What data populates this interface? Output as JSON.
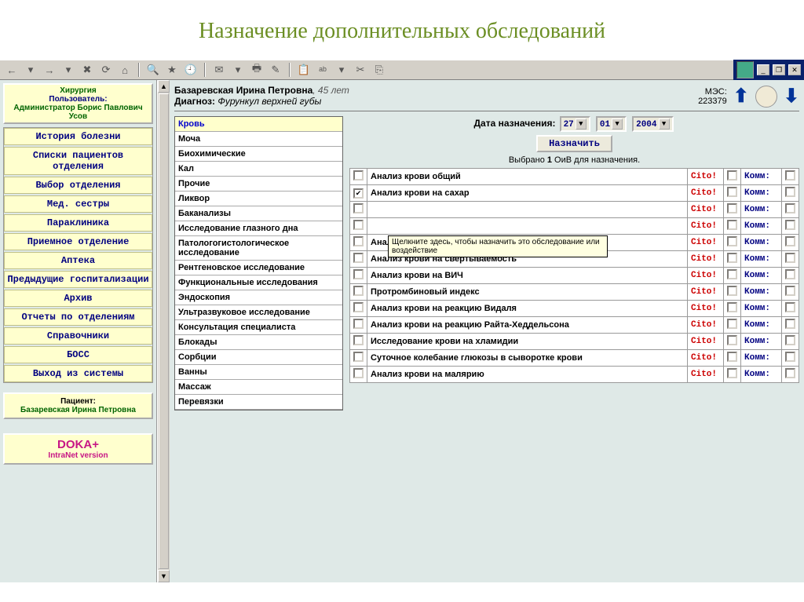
{
  "slide_title": "Назначение дополнительных обследований",
  "toolbar_icons": [
    {
      "name": "back",
      "glyph": "←"
    },
    {
      "name": "back-menu",
      "glyph": "▾"
    },
    {
      "name": "forward",
      "glyph": "→"
    },
    {
      "name": "forward-menu",
      "glyph": "▾"
    },
    {
      "name": "stop",
      "glyph": "✖"
    },
    {
      "name": "refresh",
      "glyph": "⟳"
    },
    {
      "name": "home",
      "glyph": "⌂"
    },
    {
      "name": "sep",
      "glyph": ""
    },
    {
      "name": "search",
      "glyph": "🔍"
    },
    {
      "name": "favorites",
      "glyph": "★"
    },
    {
      "name": "history",
      "glyph": "🕘"
    },
    {
      "name": "sep",
      "glyph": ""
    },
    {
      "name": "mail",
      "glyph": "✉"
    },
    {
      "name": "mail-menu",
      "glyph": "▾"
    },
    {
      "name": "print",
      "glyph": "🖶"
    },
    {
      "name": "edit",
      "glyph": "✎"
    },
    {
      "name": "sep",
      "glyph": ""
    },
    {
      "name": "paste",
      "glyph": "📋"
    },
    {
      "name": "spell",
      "glyph": "ᵃᵇ"
    },
    {
      "name": "spell-menu",
      "glyph": "▾"
    },
    {
      "name": "cut",
      "glyph": "✂"
    },
    {
      "name": "copy",
      "glyph": "⎘"
    }
  ],
  "sidebar": {
    "card1_line1": "Хирургия",
    "card1_line2": "Пользователь:",
    "card1_line3": "Администратор Борис Павлович Усов",
    "nav": [
      "История болезни",
      "Списки пациентов отделения",
      "Выбор отделения",
      "Мед. сестры",
      "Параклиника",
      "Приемное отделение",
      "Аптека",
      "Предыдущие госпитализации",
      "Архив",
      "Отчеты по отделениям",
      "Справочники",
      "БОСС",
      "Выход из системы"
    ],
    "patient_label": "Пациент:",
    "patient_name": "Базаревская Ирина Петровна",
    "brand1": "DOKA+",
    "brand2": "IntraNet version"
  },
  "header": {
    "patient_name": "Базаревская Ирина Петровна",
    "patient_age": ", 45 лет",
    "diag_label": "Диагноз: ",
    "diag_value": "Фурункул верхней губы",
    "mes_label": "МЭС:",
    "mes_value": "223379"
  },
  "categories": [
    {
      "label": "Кровь",
      "active": true
    },
    {
      "label": "Моча"
    },
    {
      "label": "Биохимические"
    },
    {
      "label": "Кал"
    },
    {
      "label": "Прочие"
    },
    {
      "label": "Ликвор"
    },
    {
      "label": "Баканализы"
    },
    {
      "label": "Исследование глазного дна"
    },
    {
      "label": "Патологогистологическое исследование"
    },
    {
      "label": "Рентгеновское исследование"
    },
    {
      "label": "Функциональные исследования"
    },
    {
      "label": "Эндоскопия"
    },
    {
      "label": "Ультразвуковое исследование"
    },
    {
      "label": "Консультация специалиста"
    },
    {
      "label": "Блокады"
    },
    {
      "label": "Сорбции"
    },
    {
      "label": "Ванны"
    },
    {
      "label": "Массаж"
    },
    {
      "label": "Перевязки"
    }
  ],
  "date_section": {
    "label": "Дата назначения:",
    "day": "27",
    "month": "01",
    "year": "2004",
    "assign_btn": "Назначить",
    "picked_prefix": "Выбрано ",
    "picked_count": "1",
    "picked_suffix": " ОиВ для назначения."
  },
  "cito_label": "Cito!",
  "comm_label": "Комм:",
  "exams": [
    {
      "name": "Анализ крови общий",
      "checked": false
    },
    {
      "name": "Анализ крови на сахар",
      "checked": true
    },
    {
      "name": "",
      "checked": false
    },
    {
      "name": "",
      "checked": false
    },
    {
      "name": "Анализ крови на RW",
      "checked": false
    },
    {
      "name": "Анализ крови на свертываемость",
      "checked": false
    },
    {
      "name": "Анализ крови на ВИЧ",
      "checked": false
    },
    {
      "name": "Протромбиновый индекс",
      "checked": false
    },
    {
      "name": "Анализ крови на реакцию Видаля",
      "checked": false
    },
    {
      "name": "Анализ крови на реакцию Райта-Хеддельсона",
      "checked": false
    },
    {
      "name": "Исследование крови на хламидии",
      "checked": false
    },
    {
      "name": "Суточное колебание глюкозы в сыворотке крови",
      "checked": false
    },
    {
      "name": "Анализ крови на малярию",
      "checked": false
    }
  ],
  "tooltip_text": "Щелкните здесь, чтобы назначить это обследование или воздействие"
}
